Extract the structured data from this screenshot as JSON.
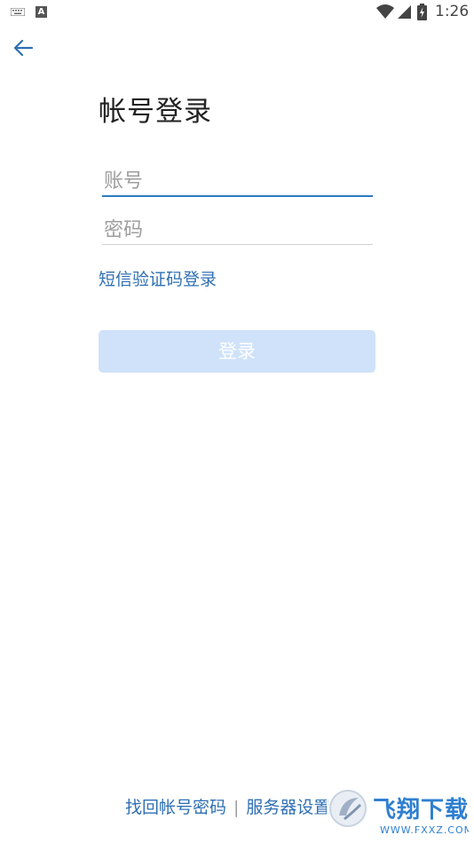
{
  "status_bar": {
    "time": "1:26",
    "icons": [
      "keyboard-icon",
      "a-notification-icon",
      "wifi-icon",
      "signal-icon",
      "battery-charging-icon"
    ]
  },
  "header": {
    "back_icon": "arrow-left-icon"
  },
  "title": "帐号登录",
  "form": {
    "account_placeholder": "账号",
    "account_value": "",
    "password_placeholder": "密码",
    "password_value": ""
  },
  "sms_login_label": "短信验证码登录",
  "login_button_label": "登录",
  "footer": {
    "find_password_label": "找回帐号密码",
    "separator": "|",
    "server_settings_label": "服务器设置"
  },
  "watermark": {
    "brand": "飞翔下载",
    "url": "WWW.FXXZ.COM"
  },
  "colors": {
    "accent": "#2a7ac3",
    "link": "#2f6fb3",
    "button_disabled_bg": "#cfe2fa",
    "title_text": "#222222",
    "placeholder": "#9e9e9e"
  }
}
